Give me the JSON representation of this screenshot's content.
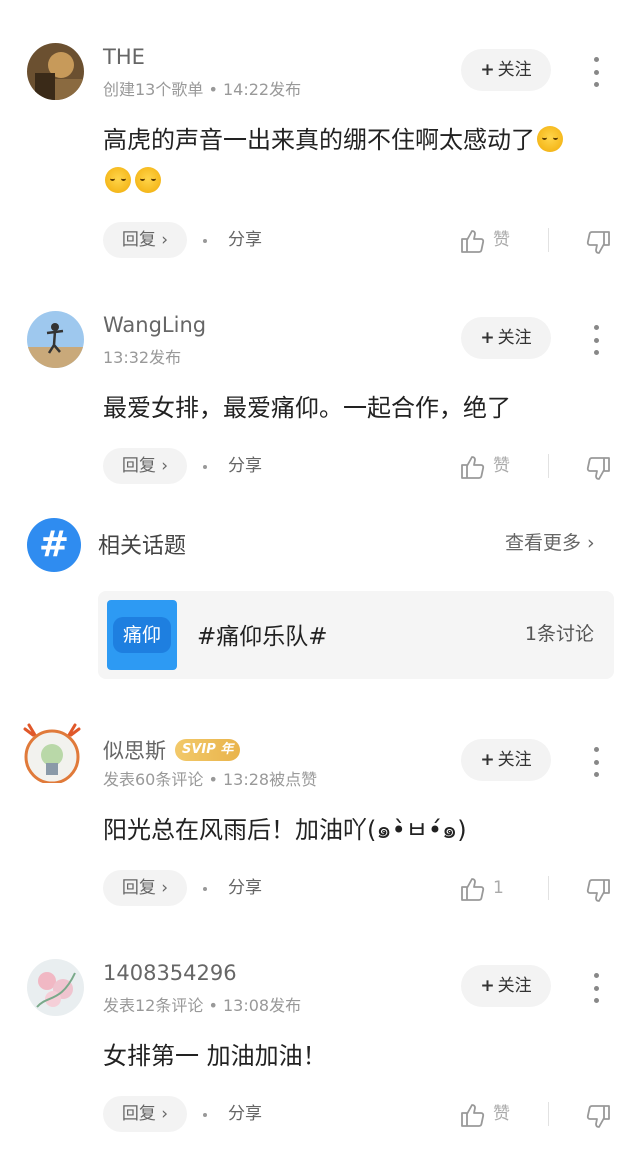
{
  "comments": [
    {
      "username": "THE",
      "meta": "创建13个歌单 • 14:22发布",
      "follow_label": "关注",
      "text": "高虎的声音一出来真的绷不住啊太感动了",
      "emoji_icon": "crying-face-emoji",
      "reply_label": "回复 ›",
      "share_label": "分享",
      "like_label": "赞"
    },
    {
      "username": "WangLing",
      "meta": "13:32发布",
      "follow_label": "关注",
      "text": "最爱女排，最爱痛仰。一起合作，绝了",
      "reply_label": "回复 ›",
      "share_label": "分享",
      "like_label": "赞"
    },
    {
      "username": "似思斯",
      "badge": "SVIP 年",
      "meta": "发表60条评论 • 13:28被点赞",
      "follow_label": "关注",
      "text": "阳光总在风雨后！加油吖(๑•̀ㅂ•́๑)",
      "reply_label": "回复 ›",
      "share_label": "分享",
      "like_label": "1"
    },
    {
      "username": "1408354296",
      "meta": "发表12条评论 • 13:08发布",
      "follow_label": "关注",
      "text": "女排第一 加油加油！",
      "reply_label": "回复 ›",
      "share_label": "分享",
      "like_label": "赞"
    }
  ],
  "topics": {
    "icon": "#",
    "title": "相关话题",
    "see_more": "查看更多 ›",
    "item": {
      "thumb_label": "痛仰",
      "name": "#痛仰乐队#",
      "count": "1条讨论"
    }
  },
  "colors": {
    "accent_blue": "#2f8cf0",
    "svip_gold": "#e9b44c"
  }
}
